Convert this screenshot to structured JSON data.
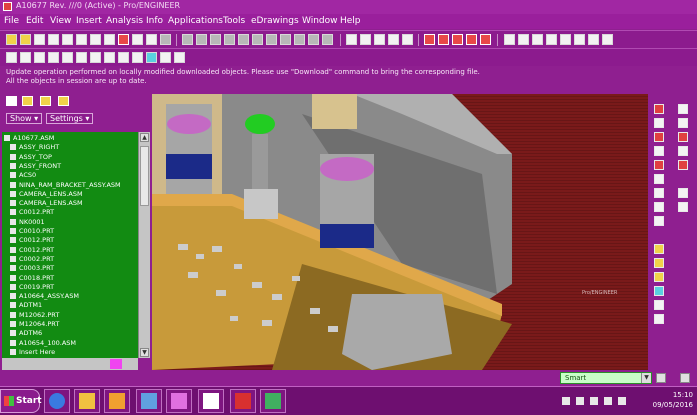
{
  "window": {
    "title": "A10677 Rev. ///0 (Active) - Pro/ENGINEER"
  },
  "menu": [
    "File",
    "Edit",
    "View",
    "Insert",
    "Analysis",
    "Info",
    "Applications",
    "Tools",
    "eDrawings",
    "Window",
    "Help"
  ],
  "messages": [
    "Update operation performed on locally modified downloaded objects. Please use \"Download\" command to bring the corresponding file.",
    "All the objects in session are up to date."
  ],
  "tree": {
    "show_label": "Show",
    "settings_label": "Settings",
    "items": [
      "A10677.ASM",
      "ASSY_RIGHT",
      "ASSY_TOP",
      "ASSY_FRONT",
      "ACS0",
      "NINA_RAM_BRACKET_ASSY.ASM",
      "CAMERA_LENS.ASM",
      "CAMERA_LENS.ASM",
      "C0012.PRT",
      "NK0001",
      "C0010.PRT",
      "C0012.PRT",
      "C0012.PRT",
      "C0002.PRT",
      "C0003.PRT",
      "C0018.PRT",
      "C0019.PRT",
      "A10664_ASSY.ASM",
      "ADTM1",
      "M12062.PRT",
      "M12064.PRT",
      "ADTM6",
      "A10654_100.ASM",
      "Insert Here"
    ]
  },
  "viewport": {
    "annotation": "Pro/ENGINEER"
  },
  "status": {
    "filter": "Smart"
  },
  "taskbar": {
    "start_label": "Start",
    "clock_time": "15:10",
    "clock_date": "09/05/2016"
  },
  "colors": {
    "theme": "#8f1f90",
    "tree_bg": "#128b12",
    "viewport_bg": "#7a1a1a",
    "board": "#c89a3a"
  }
}
